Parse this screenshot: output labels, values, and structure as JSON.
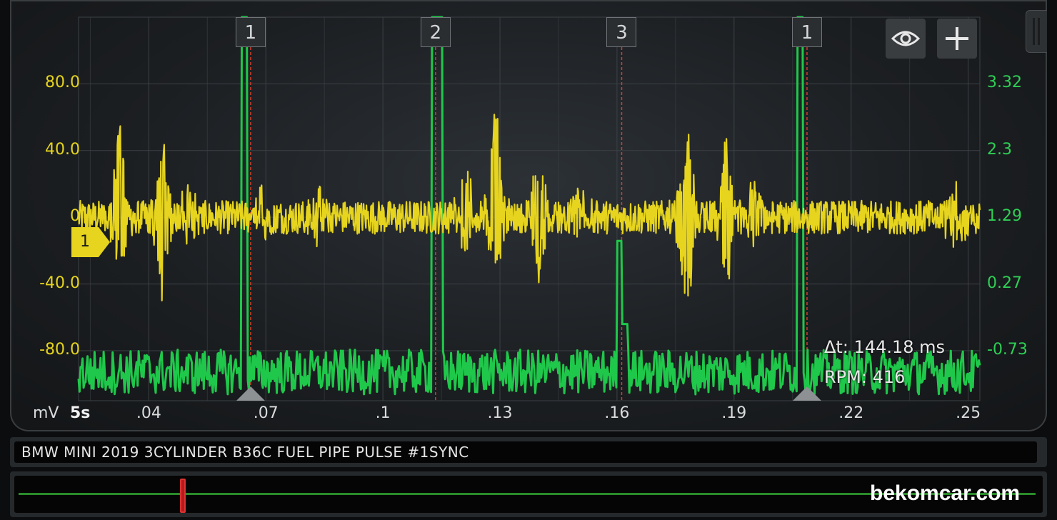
{
  "colors": {
    "channel_a": "#e6d41e",
    "channel_b": "#1fc84a",
    "cursor_line": "#d23c2c",
    "grid": "#3c4145"
  },
  "toolbar": {
    "eye_icon": "eye-icon",
    "plus_icon": "plus-icon"
  },
  "channel_marker": {
    "label": "1"
  },
  "readouts": {
    "delta_t": "Δt: 144.18 ms",
    "rpm": "RPM: 416"
  },
  "footer": {
    "title": "BMW MINI 2019 3CYLINDER B36C FUEL PIPE PULSE #1SYNC",
    "watermark": "bekomcar.com"
  },
  "chart_data": {
    "type": "line",
    "x_unit": "s",
    "x_tick_labels": [
      ".04",
      ".07",
      ".1",
      ".13",
      ".16",
      ".19",
      ".22",
      ".25"
    ],
    "x_ticks": [
      0.04,
      0.07,
      0.1,
      0.13,
      0.16,
      0.19,
      0.22,
      0.25
    ],
    "xlim": [
      0.022,
      0.253
    ],
    "timebase": "5s",
    "left_axis": {
      "unit": "mV",
      "tick_labels": [
        "80.0",
        "40.0",
        "0",
        "-40.0",
        "-80.0"
      ],
      "ticks": [
        80,
        40,
        0,
        -40,
        -80
      ],
      "ylim": [
        -110,
        120
      ]
    },
    "right_axis": {
      "tick_labels": [
        "3.32",
        "2.3",
        "1.29",
        "0.27",
        "-0.73"
      ],
      "ticks": [
        3.32,
        2.3,
        1.29,
        0.27,
        -0.73
      ],
      "ylim": [
        -1.4,
        4.6
      ]
    },
    "grid": true,
    "cylinder_markers": [
      {
        "label": "1",
        "x": 0.0661
      },
      {
        "label": "2",
        "x": 0.1135
      },
      {
        "label": "3",
        "x": 0.1612
      },
      {
        "label": "1",
        "x": 0.2087
      }
    ],
    "trigger_cursors": [
      0.0661,
      0.2087
    ],
    "series": [
      {
        "channel": "A",
        "axis": "left",
        "bursts": [
          {
            "x": 0.0325,
            "peak": 70,
            "trough": -58,
            "width": 0.004
          },
          {
            "x": 0.0435,
            "peak": 50,
            "trough": -48,
            "width": 0.004
          },
          {
            "x": 0.05,
            "peak": 18,
            "trough": -14,
            "width": 0.004
          },
          {
            "x": 0.069,
            "peak": 14,
            "trough": -12,
            "width": 0.003
          },
          {
            "x": 0.0835,
            "peak": 14,
            "trough": -16,
            "width": 0.004
          },
          {
            "x": 0.121,
            "peak": 28,
            "trough": -18,
            "width": 0.005
          },
          {
            "x": 0.129,
            "peak": 80,
            "trough": -40,
            "width": 0.004
          },
          {
            "x": 0.14,
            "peak": 40,
            "trough": -38,
            "width": 0.004
          },
          {
            "x": 0.15,
            "peak": 14,
            "trough": -12,
            "width": 0.005
          },
          {
            "x": 0.178,
            "peak": 49,
            "trough": -62,
            "width": 0.005
          },
          {
            "x": 0.188,
            "peak": 50,
            "trough": -50,
            "width": 0.004
          },
          {
            "x": 0.195,
            "peak": 22,
            "trough": -20,
            "width": 0.004
          },
          {
            "x": 0.247,
            "peak": 16,
            "trough": -16,
            "width": 0.006
          }
        ],
        "noise_amplitude": 10
      },
      {
        "channel": "B",
        "axis": "right",
        "baseline": -0.95,
        "noise_amplitude": 0.35,
        "pulses": [
          {
            "x": 0.0645,
            "peak": 4.6,
            "width": 0.0008
          },
          {
            "x": 0.114,
            "peak": 4.6,
            "width": 0.0014
          },
          {
            "x": 0.1608,
            "peak": 1.1,
            "width": 0.0008
          },
          {
            "x": 0.162,
            "peak": -0.2,
            "width": 0.0008
          },
          {
            "x": 0.207,
            "peak": 4.6,
            "width": 0.0008
          }
        ]
      }
    ]
  }
}
